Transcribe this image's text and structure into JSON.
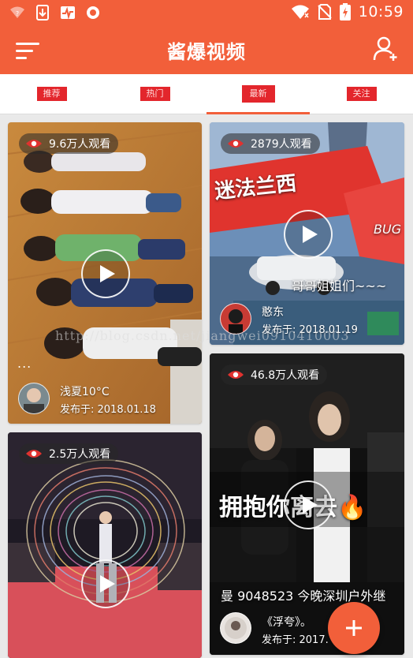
{
  "status_bar": {
    "time": "10:59",
    "left_icons": [
      "wifi-question-icon",
      "download-icon",
      "pulse-icon",
      "record-icon"
    ],
    "right_icons": [
      "wifi-icon",
      "no-sim-icon",
      "battery-charging-icon"
    ]
  },
  "app_bar": {
    "title": "酱爆视频",
    "menu_icon": "hamburger-icon",
    "user_icon": "add-user-icon"
  },
  "tabs": [
    {
      "label": "推荐",
      "active": false
    },
    {
      "label": "热门",
      "active": false
    },
    {
      "label": "最新",
      "active": true
    },
    {
      "label": "关注",
      "active": false
    }
  ],
  "cards": [
    {
      "views": "9.6万人观看",
      "user": "浅夏10°C",
      "date": "发布于: 2018.01.18",
      "more": "...",
      "overlay_text": ""
    },
    {
      "views": "2879人观看",
      "user": "憨东",
      "date": "发布于: 2018.01.19",
      "overlay_text": "哥哥姐姐们~~~",
      "banner_text": "迷法兰西",
      "bug_text": "BUG"
    },
    {
      "views": "2.5万人观看",
      "user": "",
      "date": "",
      "overlay_text": ""
    },
    {
      "views": "46.8万人观看",
      "user": "《浮夸》。",
      "date": "发布于: 2017.",
      "overlay_text": "拥抱你离去🔥",
      "caption": "曼 9048523 今晚深圳户外继"
    }
  ],
  "watermark": "http://blog.csdn.net/jiangwei0910410003",
  "fab": {
    "icon": "plus-icon"
  },
  "colors": {
    "primary": "#f25f3a",
    "tab_indicator": "#f25f3a",
    "fab": "#f25f3a"
  }
}
